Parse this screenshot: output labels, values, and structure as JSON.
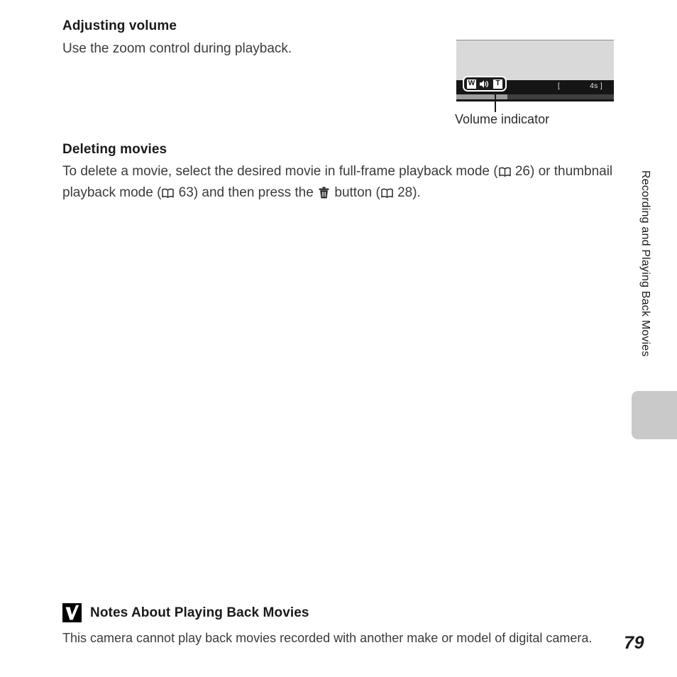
{
  "document": {
    "page_number": "79",
    "chapter_tab": "Recording and Playing Back Movies"
  },
  "adjusting_volume": {
    "heading": "Adjusting volume",
    "body": "Use the zoom control during playback."
  },
  "figure": {
    "caption": "Volume indicator",
    "screen": {
      "volume_indicator": {
        "wide_label": "W",
        "speaker_icon": "speaker-icon",
        "tele_label": "T"
      },
      "bracket_left": "[",
      "time_remaining": "4s ]"
    }
  },
  "deleting_movies": {
    "heading": "Deleting movies",
    "text_part_1": "To delete a movie, select the desired movie in full-frame playback mode (",
    "ref_1_icon": "book-icon",
    "ref_1_page": " 26) or thumbnail playback mode (",
    "ref_2_icon": "book-icon",
    "ref_2_page": " 63) and then press the ",
    "delete_icon": "trash-icon",
    "text_part_2": " button (",
    "ref_3_icon": "book-icon",
    "ref_3_page": " 28)."
  },
  "notes": {
    "caution_icon": "caution-checkmark-icon",
    "title": "Notes About Playing Back Movies",
    "body": "This camera cannot play back movies recorded with another make or model of digital camera."
  },
  "colors": {
    "screen_gray": "#d9d9d9",
    "screen_dark_band": "#151515",
    "progress_fill": "#9d9d9d",
    "progress_track": "#3f3f3f",
    "tab_mark": "#c9c9c9",
    "text": "#3b3b3b"
  }
}
